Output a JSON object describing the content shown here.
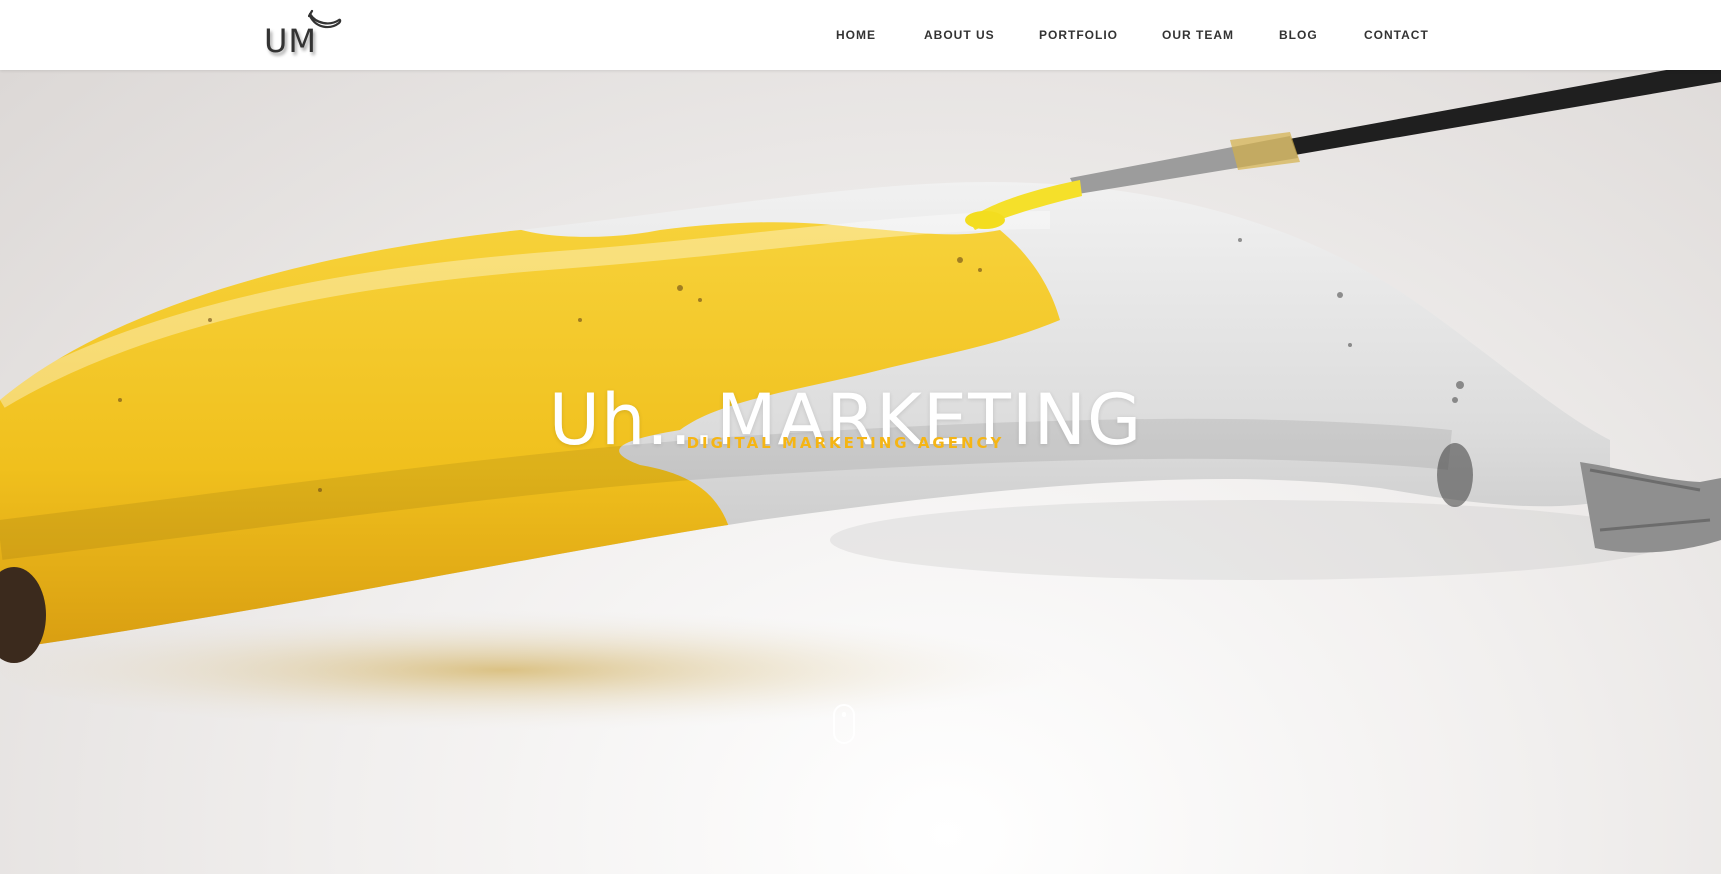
{
  "logo": {
    "text": "UM",
    "icon": "banana-icon"
  },
  "nav": {
    "items": [
      {
        "label": "HOME"
      },
      {
        "label": "ABOUT US"
      },
      {
        "label": "PORTFOLIO"
      },
      {
        "label": "OUR TEAM"
      },
      {
        "label": "BLOG"
      },
      {
        "label": "CONTACT"
      }
    ]
  },
  "hero": {
    "title": "Uh...MARKETING",
    "subtitle": "DIGITAL MARKETING AGENCY",
    "scroll_icon": "mouse-scroll-icon",
    "accent_color": "#f5b514",
    "banana_color": "#f2c21c"
  }
}
